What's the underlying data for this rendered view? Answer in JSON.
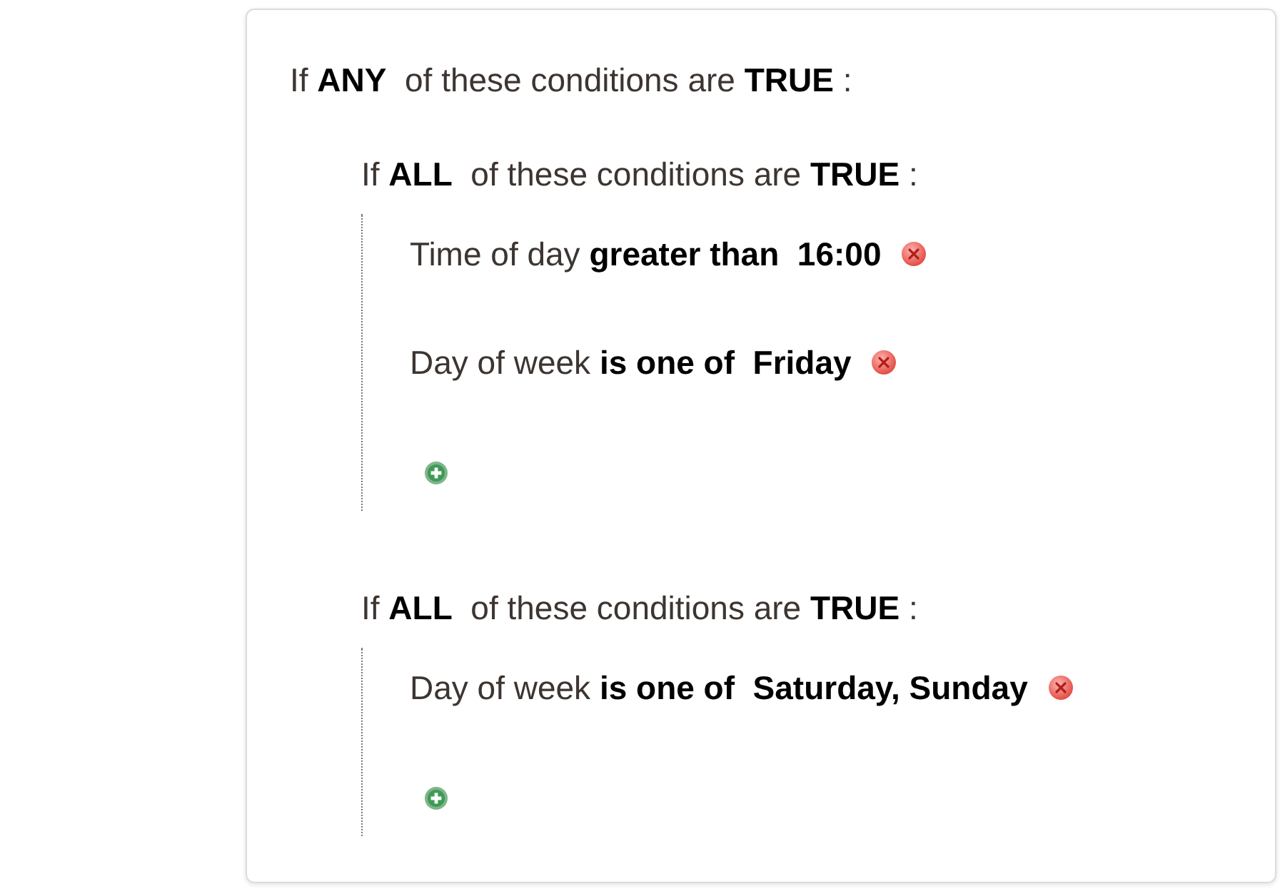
{
  "rule": {
    "heading": "If **ANY**  of these conditions are **TRUE** :",
    "groups": [
      {
        "heading": "If **ALL**  of these conditions are **TRUE** :",
        "conditions": [
          {
            "text": "Time of day **greater than  16:00**"
          },
          {
            "text": "Day of week **is one of  Friday**"
          }
        ]
      },
      {
        "heading": "If **ALL**  of these conditions are **TRUE** :",
        "conditions": [
          {
            "text": "Day of week **is one of  Saturday, Sunday**"
          }
        ]
      }
    ]
  }
}
